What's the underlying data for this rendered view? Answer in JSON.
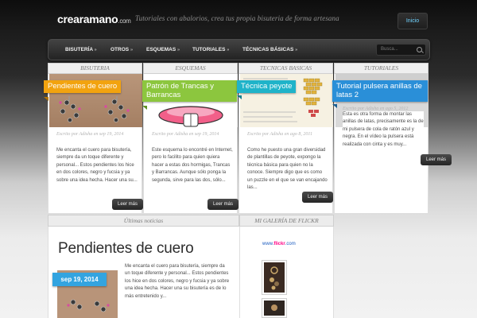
{
  "header": {
    "logo": "crearamano",
    "logo_tld": ".com",
    "tagline": "Tutoriales con abalorios, crea tus propia bisuteria de forma artesana",
    "home_button": "Inicio"
  },
  "nav": {
    "items": [
      {
        "label": "BISUTERÍA",
        "chevron": "»"
      },
      {
        "label": "OTROS",
        "chevron": "»"
      },
      {
        "label": "ESQUEMAS",
        "chevron": "»"
      },
      {
        "label": "TUTORIALES",
        "chevron": "»"
      },
      {
        "label": "TÉCNICAS BÁSICAS",
        "chevron": "»"
      }
    ],
    "search_placeholder": "Busca..."
  },
  "columns": [
    {
      "header": "BISUTERIA",
      "title": "Pendientes de cuero",
      "accent": "#f2a30f",
      "meta": "Escrito por Adisha en sep 19, 2014",
      "excerpt": "Me encanta el cuero para bisutería, siempre da un toque diferente y personal... Estos pendientes los hice en dos colores, negro y fucsia y ya sobre una idea hecha. Hacer una su...",
      "read_more": "Leer más"
    },
    {
      "header": "ESQUEMAS",
      "title": "Patrón de Trancas y Barrancas",
      "accent": "#8cc63e",
      "meta": "Escrito por Adisha en sep 19, 2014",
      "excerpt": "Este esquema lo encontré en Internet, pero lo facilito para quien quiera hacer a estas dos hormigas, Trancas y Barrancas. Aunque sólo ponga la segunda, sirve para las dos, sólo...",
      "read_more": "Leer más"
    },
    {
      "header": "TECNICAS BASICAS",
      "title": "Técnica peyote",
      "accent": "#1fb3c9",
      "meta": "Escrito por Adisha en ago 8, 2011",
      "excerpt": "Como he puesto una gran diversidad de plantillas de peyote, expongo la técnica básica para quien no la conoce. Siempre digo que es como un puzzle en el que se van encajando las...",
      "read_more": "Leer más"
    },
    {
      "header": "TUTORIALES",
      "title": "Tutorial pulsera anillas de latas 2",
      "accent": "#2a8fd8",
      "meta": "Escrito por Adisha en ago 5, 2012",
      "excerpt": "Esta es otra forma de montar las anillas de latas, precisamente es la de mi pulsera de cola de ratón azul y negra. En el vídeo la pulsera está realizada con cinta y es muy...",
      "read_more": "Leer más"
    }
  ],
  "news": {
    "header": "Últimas noticias",
    "title": "Pendientes de cuero",
    "date": "sep 19, 2014",
    "excerpt": "Me encanta el cuero para bisutería, siempre da un toque diferente y personal... Estos pendientes los hice en dos colores, negro y fucsia y ya sobre una idea hecha. Hacer una su bisutería es de lo más entretenido y..."
  },
  "flickr": {
    "header": "MI GALERÍA DE FLICKR",
    "link_prefix": "www.",
    "link_brand": "flickr",
    "link_suffix": ".com"
  }
}
